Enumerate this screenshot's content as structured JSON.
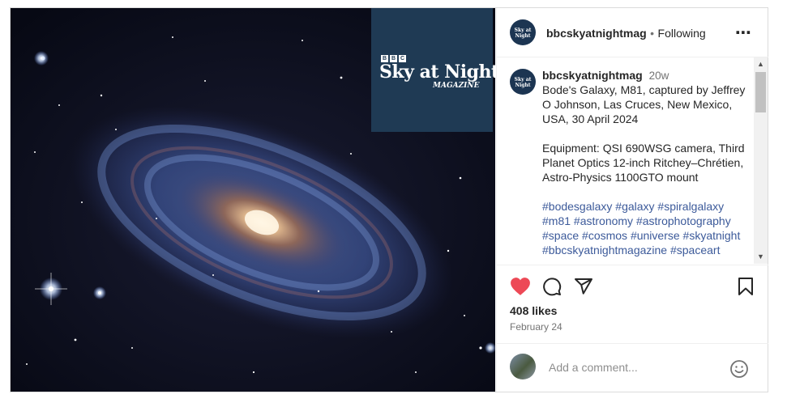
{
  "post": {
    "username": "bbcskyatnightmag",
    "separator": "•",
    "follow_status": "Following",
    "more_icon": "⋯",
    "brand_bbc": [
      "B",
      "B",
      "C"
    ],
    "brand_title": "Sky at Night",
    "brand_subtitle": "MAGAZINE"
  },
  "caption": {
    "username": "bbcskyatnightmag",
    "time": "20w",
    "text": "Bode's Galaxy, M81, captured by Jeffrey O Johnson, Las Cruces, New Mexico, USA, 30 April 2024\n\nEquipment: QSI 690WSG camera, Third Planet Optics 12-inch Ritchey–Chrétien, Astro-Physics 1100GTO mount\n\n",
    "hashtags": "#bodesgalaxy #galaxy #spiralgalaxy #m81 #astronomy #astrophotography #space #cosmos #universe #skyatnight #bbcskyatnightmagazine #spaceart"
  },
  "engagement": {
    "likes": "408 likes",
    "date": "February 24",
    "liked": true
  },
  "comment": {
    "placeholder": "Add a comment..."
  },
  "colors": {
    "like_red": "#ed4956",
    "link_blue": "#3c5a9a",
    "brand_navy": "#1f3a54"
  },
  "icons": {
    "like": "heart-icon",
    "comment": "comment-icon",
    "share": "share-icon",
    "save": "bookmark-icon",
    "emoji": "emoji-icon"
  }
}
